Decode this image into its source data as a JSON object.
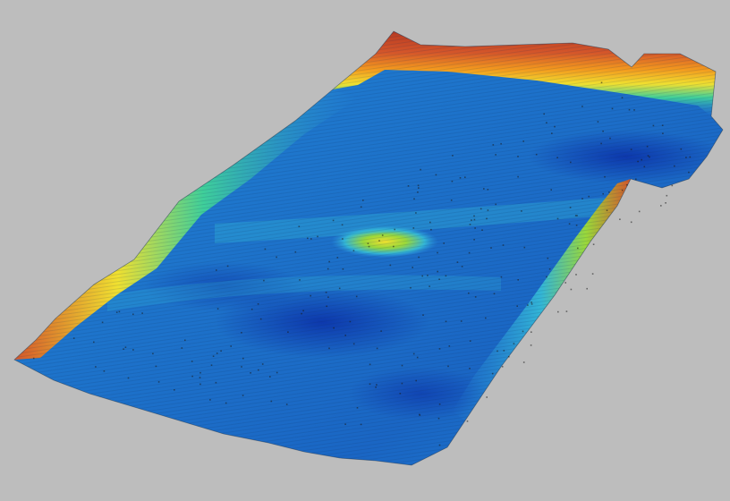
{
  "scene": {
    "kind": "3d-bathymetric-terrain-render",
    "background_color": "#bdbdbd",
    "colormap": [
      "#0a2fa8",
      "#1a5fd0",
      "#2a8fdc",
      "#33b6d6",
      "#3fcf9a",
      "#9ad83a",
      "#f0e030",
      "#f39a1e",
      "#d4562a",
      "#b83a22"
    ],
    "visible_text": []
  }
}
